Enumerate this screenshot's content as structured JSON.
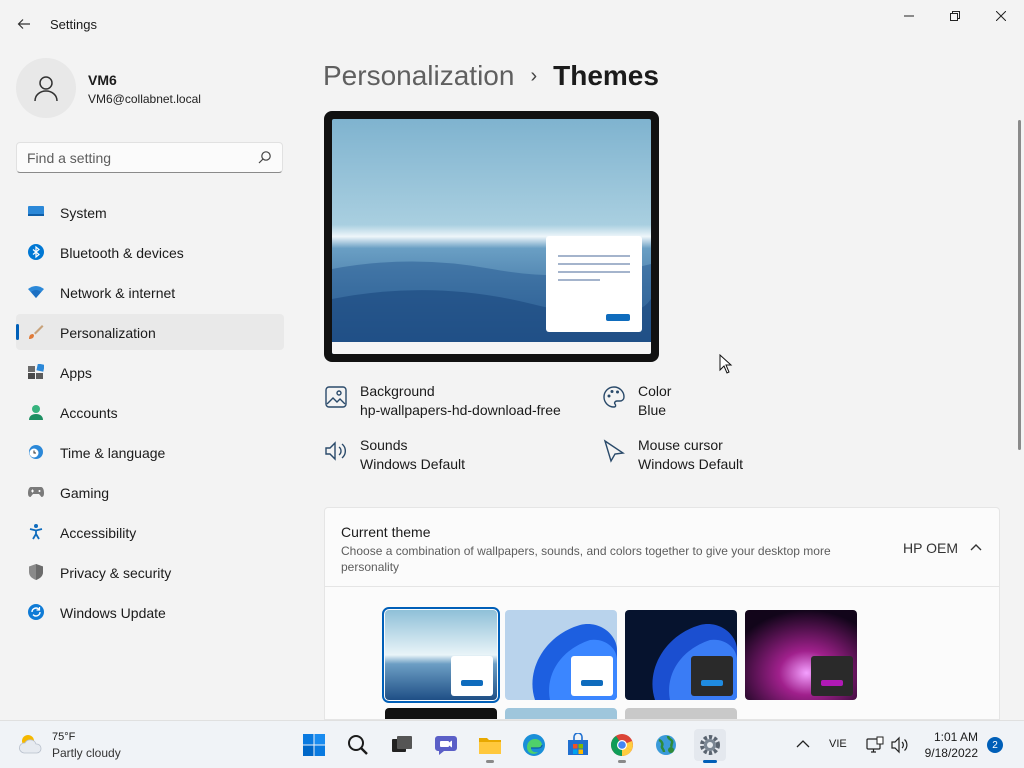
{
  "window": {
    "title": "Settings",
    "controls": {
      "minimize": "─",
      "maximize": "❐",
      "close": "✕"
    },
    "back": "←"
  },
  "profile": {
    "name": "VM6",
    "email": "VM6@collabnet.local"
  },
  "search": {
    "placeholder": "Find a setting"
  },
  "sidebar": {
    "items": [
      {
        "label": "System",
        "icon": "monitor-icon"
      },
      {
        "label": "Bluetooth & devices",
        "icon": "bluetooth-icon"
      },
      {
        "label": "Network & internet",
        "icon": "wifi-icon"
      },
      {
        "label": "Personalization",
        "icon": "brush-icon",
        "selected": true
      },
      {
        "label": "Apps",
        "icon": "apps-icon"
      },
      {
        "label": "Accounts",
        "icon": "person-icon"
      },
      {
        "label": "Time & language",
        "icon": "clock-globe-icon"
      },
      {
        "label": "Gaming",
        "icon": "gamepad-icon"
      },
      {
        "label": "Accessibility",
        "icon": "accessibility-icon"
      },
      {
        "label": "Privacy & security",
        "icon": "shield-icon"
      },
      {
        "label": "Windows Update",
        "icon": "update-icon"
      }
    ]
  },
  "breadcrumb": {
    "parent": "Personalization",
    "separator": "›",
    "current": "Themes"
  },
  "properties": {
    "background": {
      "label": "Background",
      "value": "hp-wallpapers-hd-download-free"
    },
    "color": {
      "label": "Color",
      "value": "Blue"
    },
    "sounds": {
      "label": "Sounds",
      "value": "Windows Default"
    },
    "cursor": {
      "label": "Mouse cursor",
      "value": "Windows Default"
    }
  },
  "current_theme": {
    "title": "Current theme",
    "description": "Choose a combination of wallpapers, sounds, and colors together to give your desktop more personality",
    "value": "HP OEM"
  },
  "taskbar": {
    "weather": {
      "temp": "75°F",
      "desc": "Partly cloudy"
    },
    "language": "VIE",
    "time": "1:01 AM",
    "date": "9/18/2022",
    "notifications": "2",
    "tray_chevron": "^"
  },
  "colors": {
    "accent": "#005fb8"
  }
}
